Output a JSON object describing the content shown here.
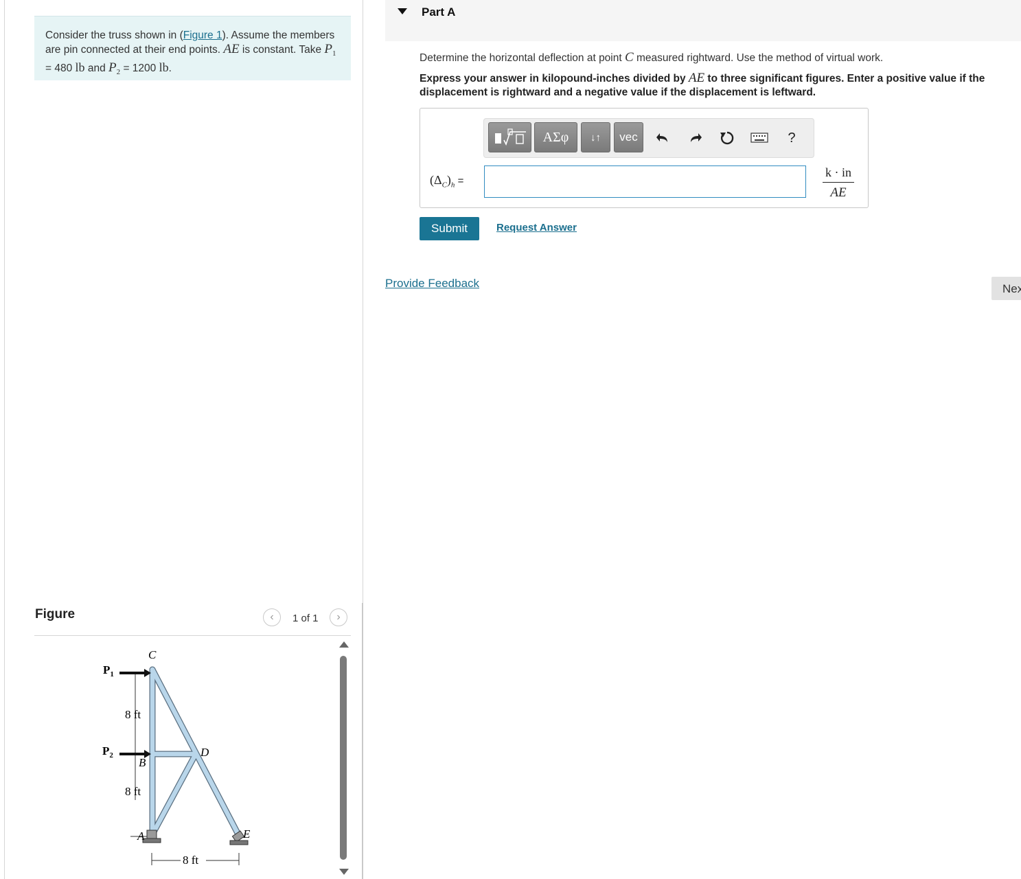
{
  "problem": {
    "text_1": "Consider the truss shown in (",
    "figure_link": "Figure 1",
    "text_2": "). Assume the members are pin connected at their end points. ",
    "ae": "AE",
    "text_3": " is constant. Take ",
    "p1": "P",
    "p1_sub": "1",
    "eq1": " = 480 ",
    "unit1": "lb",
    "text_4": " and ",
    "p2": "P",
    "p2_sub": "2",
    "eq2": " = 1200 ",
    "unit2": "lb",
    "end": "."
  },
  "figure": {
    "title": "Figure",
    "counter": "1 of 1",
    "labels": {
      "c": "C",
      "b": "B",
      "d": "D",
      "a": "A",
      "e": "E",
      "p1": "P",
      "p1_sub": "1",
      "p2": "P",
      "p2_sub": "2",
      "dim_upper": "8 ft",
      "dim_lower": "8 ft",
      "dim_base": "8 ft"
    }
  },
  "part": {
    "title": "Part A",
    "question_1": "Determine the horizontal deflection at point ",
    "question_point": "C",
    "question_2": " measured rightward. Use the method of virtual work.",
    "instr_1": "Express your answer in kilopound-inches divided by ",
    "instr_ae": "AE",
    "instr_2": " to three significant figures. Enter a positive value if the displacement is rightward and a negative value if the displacement is leftward."
  },
  "toolbar": {
    "templates_label": "",
    "greek_label": "ΑΣφ",
    "arrows_label": "↓↑",
    "vec_label": "vec",
    "help_label": "?"
  },
  "answer": {
    "lhs_open": "(Δ",
    "lhs_sub_c": "C",
    "lhs_close": ")",
    "lhs_sub_h": "h",
    "lhs_eq": " =",
    "value": "",
    "units_num": "k · in",
    "units_den": "AE"
  },
  "actions": {
    "submit": "Submit",
    "request_answer": "Request Answer",
    "provide_feedback": "Provide Feedback",
    "next": "Nex"
  },
  "colors": {
    "accent": "#1a7594",
    "link": "#1b6f8e",
    "problem_bg": "#e6f4f5",
    "member": "#aecde2"
  }
}
